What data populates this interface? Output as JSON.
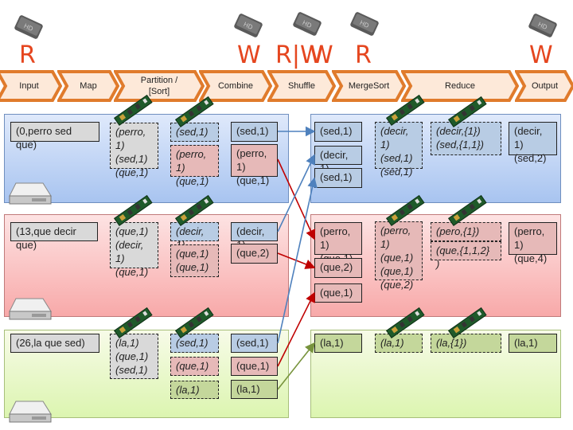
{
  "io_labels": {
    "input_read": "R",
    "combine_write": "W",
    "shuffle_read_write": "R|W",
    "shuffle_write": "W",
    "merge_read": "R",
    "output_write": "W"
  },
  "stages": [
    "Input",
    "Map",
    "Partition /\n[Sort]",
    "Combine",
    "Shuffle",
    "MergeSort",
    "Reduce",
    "Output"
  ],
  "colors": {
    "io_letter": "#e5461f",
    "chevron_border": "#e07b2c",
    "chevron_fill": "#fde9d9",
    "key_sed": "#b8cce4",
    "key_perro_que": "#e6b9b8",
    "key_la": "#c4d79b",
    "line_blue": "#4f81bd",
    "line_red": "#c00000",
    "line_green": "#77933c"
  },
  "icons": {
    "disk": "hard-disk-icon",
    "memory": "ram-module-icon",
    "node": "server-icon"
  },
  "rows": [
    {
      "input": "(0,perro sed\nque)",
      "map": "(perro,\n1)\n(sed,1)\n(que,1)",
      "partition": [
        "(sed,1)",
        "(perro,\n1)\n(que,1)"
      ],
      "combine": [
        "(sed,1)",
        "(perro,\n1)\n(que,1)"
      ],
      "shuffle": [
        "(sed,1)",
        "(decir,\n1)",
        "(sed,1)"
      ],
      "mergesort": "(decir,\n1)\n(sed,1)\n(sed,1)",
      "reduce": [
        "(decir,{1})\n(sed,{1,1})"
      ],
      "output": "(decir,\n1)\n(sed,2)"
    },
    {
      "input": "(13,que decir\nque)",
      "map": "(que,1)\n(decir,\n1)\n(que,1)",
      "partition": [
        "(decir,\n1)",
        "(que,1)\n(que,1)"
      ],
      "combine": [
        "(decir,\n1)",
        "(que,2)"
      ],
      "shuffle": [
        "(perro,\n1)\n(que,1)",
        "(que,2)",
        "(que,1)"
      ],
      "mergesort": "(perro,\n1)\n(que,1)\n(que,1)\n(que,2)",
      "reduce": [
        "(pero,{1})",
        "(que,{1,1,2}\n)"
      ],
      "output": "(perro,\n1)\n(que,4)"
    },
    {
      "input": "(26,la que sed)",
      "map": "(la,1)\n(que,1)\n(sed,1)",
      "partition": [
        "(sed,1)",
        "(que,1)",
        "(la,1)"
      ],
      "combine": [
        "(sed,1)",
        "(que,1)",
        "(la,1)"
      ],
      "shuffle": [
        "(la,1)"
      ],
      "mergesort": "(la,1)",
      "reduce": [
        "(la,{1})"
      ],
      "output": "(la,1)"
    }
  ]
}
